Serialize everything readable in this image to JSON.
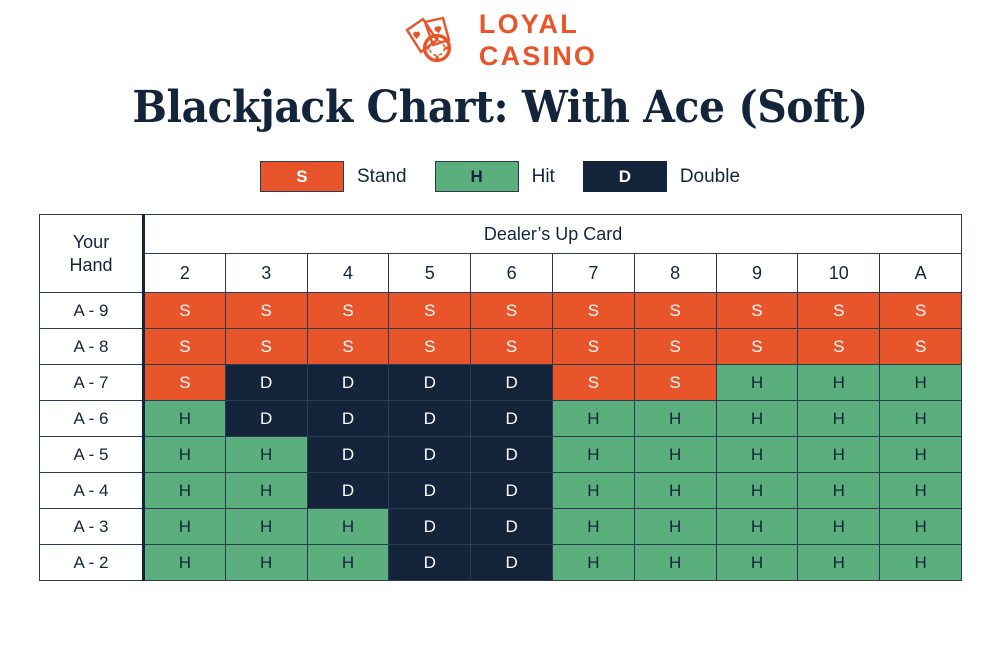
{
  "brand": {
    "line1": "LOYAL",
    "line2": "CASINO",
    "color": "#E8552A",
    "mark": "cards-and-chip-icon"
  },
  "title": "Blackjack Chart: With Ace (Soft)",
  "legend": {
    "items": [
      {
        "code": "S",
        "label": "Stand",
        "bg": "#E8552A",
        "fg": "#FFFFFF"
      },
      {
        "code": "H",
        "label": "Hit",
        "bg": "#5AAF7C",
        "fg": "#14253B"
      },
      {
        "code": "D",
        "label": "Double",
        "bg": "#14253B",
        "fg": "#FFFFFF"
      }
    ]
  },
  "table": {
    "corner_line1": "Your",
    "corner_line2": "Hand",
    "dealer_header": "Dealer’s Up Card",
    "columns": [
      "2",
      "3",
      "4",
      "5",
      "6",
      "7",
      "8",
      "9",
      "10",
      "A"
    ],
    "rows": [
      {
        "hand": "A - 9",
        "cells": [
          "S",
          "S",
          "S",
          "S",
          "S",
          "S",
          "S",
          "S",
          "S",
          "S"
        ]
      },
      {
        "hand": "A - 8",
        "cells": [
          "S",
          "S",
          "S",
          "S",
          "S",
          "S",
          "S",
          "S",
          "S",
          "S"
        ]
      },
      {
        "hand": "A - 7",
        "cells": [
          "S",
          "D",
          "D",
          "D",
          "D",
          "S",
          "S",
          "H",
          "H",
          "H"
        ]
      },
      {
        "hand": "A - 6",
        "cells": [
          "H",
          "D",
          "D",
          "D",
          "D",
          "H",
          "H",
          "H",
          "H",
          "H"
        ]
      },
      {
        "hand": "A - 5",
        "cells": [
          "H",
          "H",
          "D",
          "D",
          "D",
          "H",
          "H",
          "H",
          "H",
          "H"
        ]
      },
      {
        "hand": "A - 4",
        "cells": [
          "H",
          "H",
          "D",
          "D",
          "D",
          "H",
          "H",
          "H",
          "H",
          "H"
        ]
      },
      {
        "hand": "A - 3",
        "cells": [
          "H",
          "H",
          "H",
          "D",
          "D",
          "H",
          "H",
          "H",
          "H",
          "H"
        ]
      },
      {
        "hand": "A - 2",
        "cells": [
          "H",
          "H",
          "H",
          "D",
          "D",
          "H",
          "H",
          "H",
          "H",
          "H"
        ]
      }
    ]
  },
  "chart_data": {
    "type": "table",
    "title": "Blackjack Chart: With Ace (Soft)",
    "xlabel": "Dealer’s Up Card",
    "ylabel": "Your Hand",
    "categories": [
      "2",
      "3",
      "4",
      "5",
      "6",
      "7",
      "8",
      "9",
      "10",
      "A"
    ],
    "series": [
      {
        "name": "A - 9",
        "values": [
          "S",
          "S",
          "S",
          "S",
          "S",
          "S",
          "S",
          "S",
          "S",
          "S"
        ]
      },
      {
        "name": "A - 8",
        "values": [
          "S",
          "S",
          "S",
          "S",
          "S",
          "S",
          "S",
          "S",
          "S",
          "S"
        ]
      },
      {
        "name": "A - 7",
        "values": [
          "S",
          "D",
          "D",
          "D",
          "D",
          "S",
          "S",
          "H",
          "H",
          "H"
        ]
      },
      {
        "name": "A - 6",
        "values": [
          "H",
          "D",
          "D",
          "D",
          "D",
          "H",
          "H",
          "H",
          "H",
          "H"
        ]
      },
      {
        "name": "A - 5",
        "values": [
          "H",
          "H",
          "D",
          "D",
          "D",
          "H",
          "H",
          "H",
          "H",
          "H"
        ]
      },
      {
        "name": "A - 4",
        "values": [
          "H",
          "H",
          "D",
          "D",
          "D",
          "H",
          "H",
          "H",
          "H",
          "H"
        ]
      },
      {
        "name": "A - 3",
        "values": [
          "H",
          "H",
          "H",
          "D",
          "D",
          "H",
          "H",
          "H",
          "H",
          "H"
        ]
      },
      {
        "name": "A - 2",
        "values": [
          "H",
          "H",
          "H",
          "D",
          "D",
          "H",
          "H",
          "H",
          "H",
          "H"
        ]
      }
    ],
    "legend": [
      {
        "key": "S",
        "meaning": "Stand",
        "color": "#E8552A"
      },
      {
        "key": "H",
        "meaning": "Hit",
        "color": "#5AAF7C"
      },
      {
        "key": "D",
        "meaning": "Double",
        "color": "#14253B"
      }
    ],
    "legend_position": "top-center",
    "grid": true
  }
}
